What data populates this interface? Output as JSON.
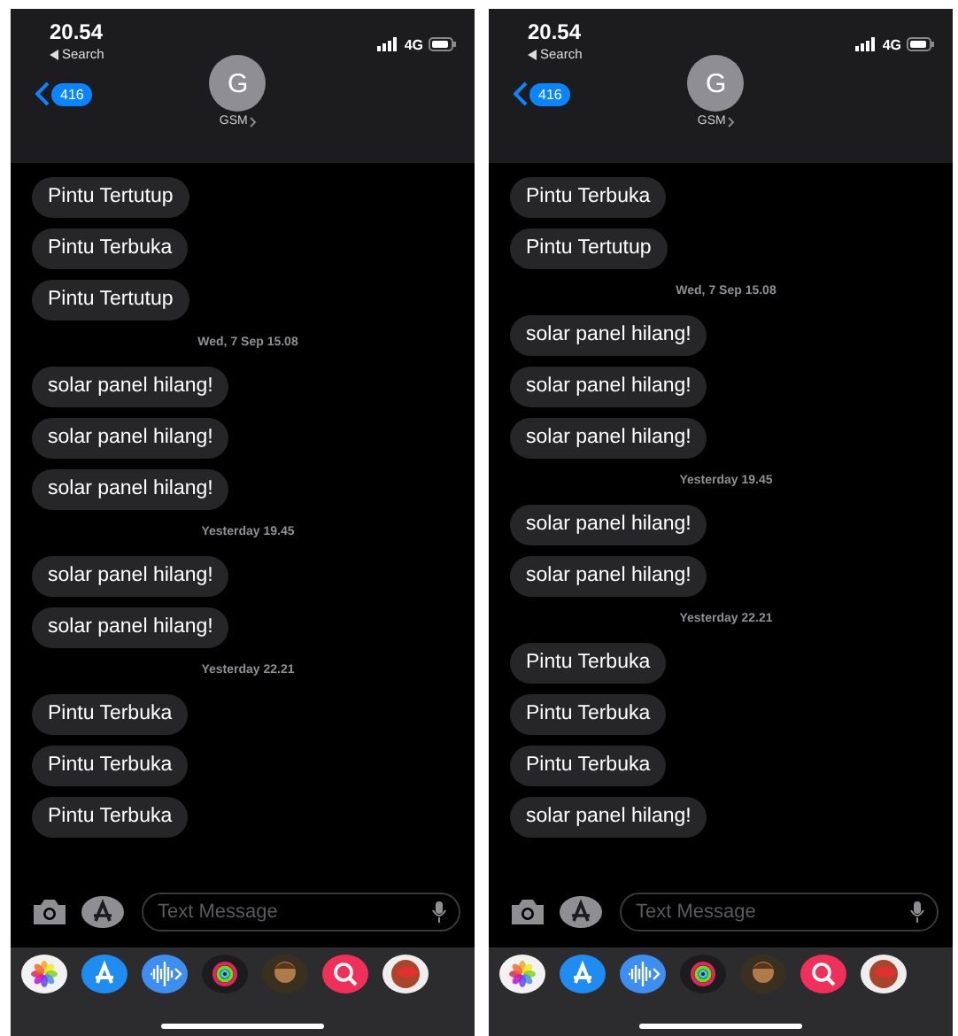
{
  "phones": [
    {
      "status_bar": {
        "time": "20.54",
        "back_app": "Search",
        "network": "4G"
      },
      "header": {
        "unread_count": "416",
        "avatar_initial": "G",
        "contact_name": "GSM"
      },
      "messages": [
        {
          "kind": "bubble",
          "text": "Pintu Tertutup"
        },
        {
          "kind": "bubble",
          "text": "Pintu Terbuka"
        },
        {
          "kind": "bubble",
          "text": "Pintu Tertutup"
        },
        {
          "kind": "timestamp",
          "text": "Wed, 7 Sep 15.08"
        },
        {
          "kind": "bubble",
          "text": "solar panel hilang!"
        },
        {
          "kind": "bubble",
          "text": "solar panel hilang!"
        },
        {
          "kind": "bubble",
          "text": "solar panel hilang!"
        },
        {
          "kind": "timestamp",
          "text": "Yesterday 19.45"
        },
        {
          "kind": "bubble",
          "text": "solar panel hilang!"
        },
        {
          "kind": "bubble",
          "text": "solar panel hilang!"
        },
        {
          "kind": "timestamp",
          "text": "Yesterday 22.21"
        },
        {
          "kind": "bubble",
          "text": "Pintu Terbuka"
        },
        {
          "kind": "bubble",
          "text": "Pintu Terbuka"
        },
        {
          "kind": "bubble",
          "text": "Pintu Terbuka"
        }
      ],
      "composer": {
        "placeholder": "Text Message"
      }
    },
    {
      "status_bar": {
        "time": "20.54",
        "back_app": "Search",
        "network": "4G"
      },
      "header": {
        "unread_count": "416",
        "avatar_initial": "G",
        "contact_name": "GSM"
      },
      "messages": [
        {
          "kind": "bubble",
          "text": "Pintu Terbuka"
        },
        {
          "kind": "bubble",
          "text": "Pintu Tertutup"
        },
        {
          "kind": "timestamp",
          "text": "Wed, 7 Sep 15.08"
        },
        {
          "kind": "bubble",
          "text": "solar panel hilang!"
        },
        {
          "kind": "bubble",
          "text": "solar panel hilang!"
        },
        {
          "kind": "bubble",
          "text": "solar panel hilang!"
        },
        {
          "kind": "timestamp",
          "text": "Yesterday 19.45"
        },
        {
          "kind": "bubble",
          "text": "solar panel hilang!"
        },
        {
          "kind": "bubble",
          "text": "solar panel hilang!"
        },
        {
          "kind": "timestamp",
          "text": "Yesterday 22.21"
        },
        {
          "kind": "bubble",
          "text": "Pintu Terbuka"
        },
        {
          "kind": "bubble",
          "text": "Pintu Terbuka"
        },
        {
          "kind": "bubble",
          "text": "Pintu Terbuka"
        },
        {
          "kind": "bubble",
          "text": "solar panel hilang!"
        }
      ],
      "composer": {
        "placeholder": "Text Message"
      }
    }
  ]
}
